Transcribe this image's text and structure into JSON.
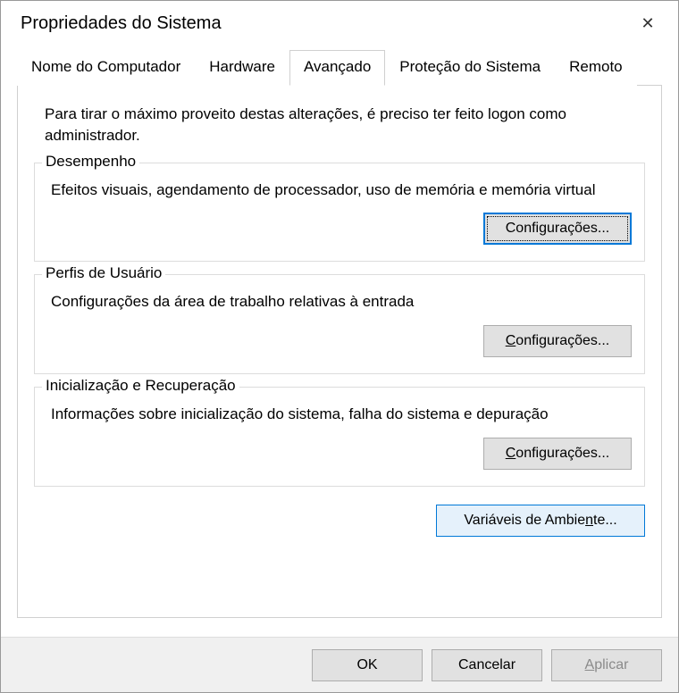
{
  "window": {
    "title": "Propriedades do Sistema"
  },
  "tabs": {
    "computer_name": "Nome do Computador",
    "hardware": "Hardware",
    "advanced": "Avançado",
    "system_protection": "Proteção do Sistema",
    "remote": "Remoto"
  },
  "content": {
    "intro": "Para tirar o máximo proveito destas alterações, é preciso ter feito logon como administrador.",
    "performance": {
      "legend": "Desempenho",
      "desc": "Efeitos visuais, agendamento de processador, uso de memória e memória virtual",
      "button": "Configurações..."
    },
    "user_profiles": {
      "legend": "Perfis de Usuário",
      "desc": "Configurações da área de trabalho relativas à entrada",
      "button_prefix": "C",
      "button_rest": "onfigurações..."
    },
    "startup_recovery": {
      "legend": "Inicialização e Recuperação",
      "desc": "Informações sobre inicialização do sistema, falha do sistema e depuração",
      "button_prefix": "C",
      "button_rest": "onfigurações..."
    },
    "env_var_prefix": "Variáveis de Ambie",
    "env_var_u": "n",
    "env_var_rest": "te..."
  },
  "buttons": {
    "ok": "OK",
    "cancel": "Cancelar",
    "apply_prefix": "A",
    "apply_rest": "plicar"
  }
}
